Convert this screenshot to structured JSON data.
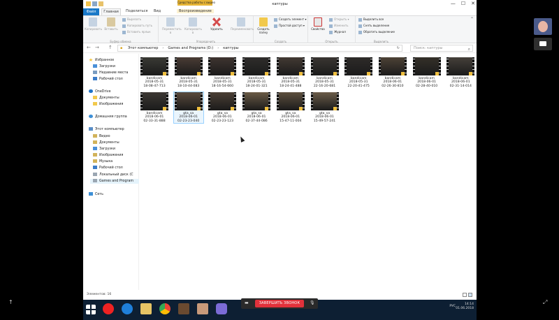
{
  "window": {
    "title": "каптуры",
    "context_group": "Средства работы с видео",
    "tabs": [
      "Главная",
      "Поделиться",
      "Вид",
      "Воспроизведение"
    ],
    "file_tab": "Файл",
    "controls": {
      "minimize": "—",
      "maximize": "☐",
      "close": "✕"
    }
  },
  "ribbon": {
    "clipboard": {
      "label": "Буфер обмена",
      "copy_path": "Копировать путь",
      "paste_shortcut": "Вставить ярлык",
      "cut": "Вырезать",
      "copy": "Копировать",
      "paste": "Вставить"
    },
    "organize": {
      "label": "Упорядочить",
      "move_to": "Переместить в",
      "copy_to": "Копировать в",
      "delete": "Удалить",
      "rename": "Переименовать"
    },
    "new": {
      "label": "Создать",
      "new_item": "Создать элемент",
      "easy_access": "Простой доступ",
      "new_folder": "Создать папку"
    },
    "open": {
      "label": "Открыть",
      "properties": "Свойства",
      "open": "Открыть",
      "edit": "Изменить",
      "history": "Журнал"
    },
    "select": {
      "label": "Выделить",
      "select_all": "Выделить все",
      "select_none": "Снять выделение",
      "invert": "Обратить выделение"
    }
  },
  "addressbar": {
    "path": [
      "Этот компьютер",
      "Games and Programs (D:)",
      "каптуры"
    ],
    "search_placeholder": "Поиск: каптуры",
    "back": "←",
    "forward": "→",
    "up": "↑",
    "refresh": "↻"
  },
  "nav": {
    "favorites": "Избранное",
    "fav_items": [
      "Загрузки",
      "Недавние места",
      "Рабочий стол"
    ],
    "onedrive": "OneDrive",
    "onedrive_items": [
      "Документы",
      "Изображения"
    ],
    "homegroup": "Домашняя группа",
    "thispc": "Этот компьютер",
    "pc_items": [
      "Видео",
      "Документы",
      "Загрузки",
      "Изображения",
      "Музыка",
      "Рабочий стол",
      "Локальный диск (C",
      "Games and Program"
    ],
    "network": "Сеть"
  },
  "files": [
    {
      "name": "bandicam",
      "date": "2018-05-31",
      "time": "18-08-47-713"
    },
    {
      "name": "bandicam",
      "date": "2018-05-31",
      "time": "18-10-44-083"
    },
    {
      "name": "bandicam",
      "date": "2018-05-31",
      "time": "18-16-54-660"
    },
    {
      "name": "bandicam",
      "date": "2018-05-31",
      "time": "18-24-01-321"
    },
    {
      "name": "bandicam",
      "date": "2018-05-31",
      "time": "18-24-41-488"
    },
    {
      "name": "bandicam",
      "date": "2018-05-31",
      "time": "22-16-20-681"
    },
    {
      "name": "bandicam",
      "date": "2018-05-31",
      "time": "22-20-41-475"
    },
    {
      "name": "bandicam",
      "date": "2018-06-01",
      "time": "02-26-30-810"
    },
    {
      "name": "bandicam",
      "date": "2018-06-01",
      "time": "02-28-40-010"
    },
    {
      "name": "bandicam",
      "date": "2018-06-01",
      "time": "02-31-14-014"
    },
    {
      "name": "bandicam",
      "date": "2018-06-01",
      "time": "02-33-31-888"
    },
    {
      "name": "gta_sa",
      "date": "2018-06-01",
      "time": "02-23-23-040"
    },
    {
      "name": "gta_sa",
      "date": "2018-06-01",
      "time": "02-23-23-123"
    },
    {
      "name": "gta_sa",
      "date": "2018-06-01",
      "time": "02-37-44-086"
    },
    {
      "name": "gta_sa",
      "date": "2018-06-01",
      "time": "15-47-11-004"
    },
    {
      "name": "gta_sa",
      "date": "2018-06-01",
      "time": "15-49-57-241"
    }
  ],
  "status": {
    "count": "Элементов: 16"
  },
  "taskbar": {
    "lang": "РУС",
    "time": "14:14",
    "date": "01.06.2018"
  },
  "call": {
    "end_call": "ЗАВЕРШИТЬ ЗВОНОК"
  },
  "colors": {
    "accent": "#1a79c8",
    "end_call": "#e2323b",
    "taskbar": "#0d1f33",
    "context": "#e6b434"
  }
}
